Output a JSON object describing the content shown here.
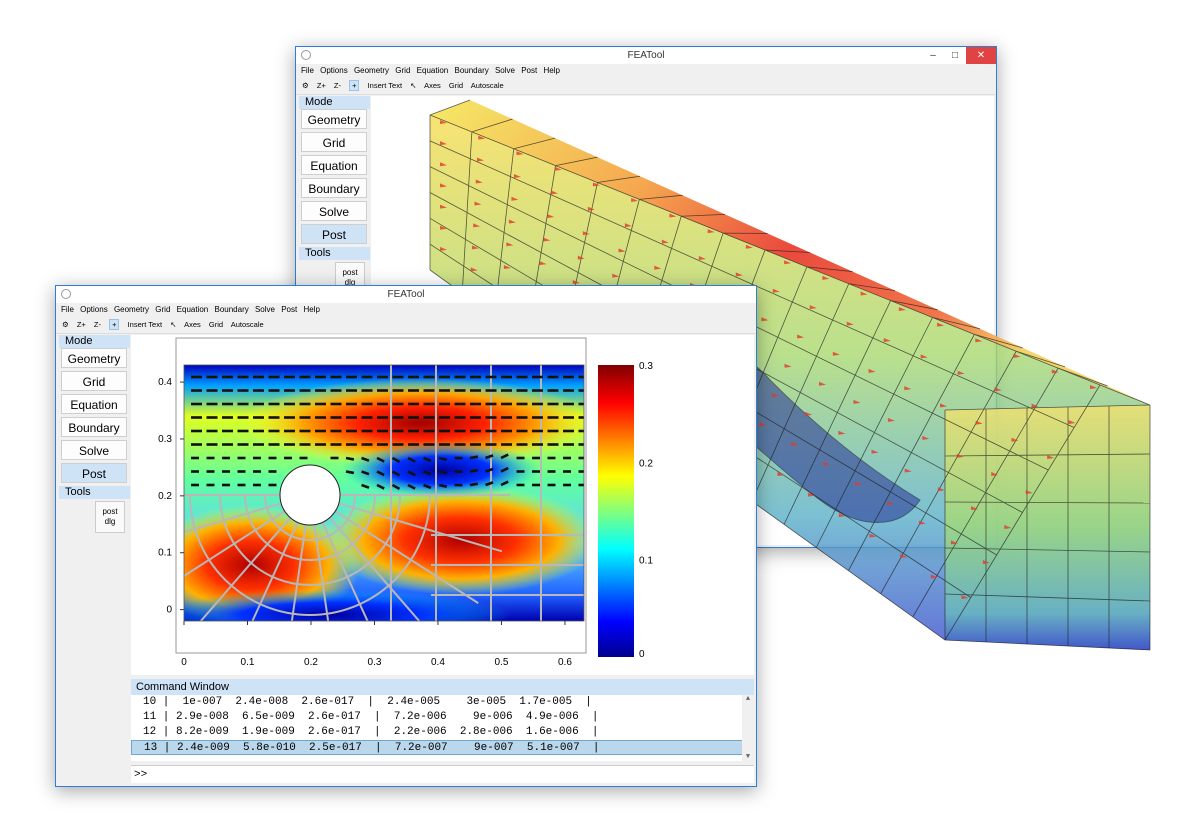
{
  "window_back": {
    "title": "FEATool",
    "menu": [
      "File",
      "Options",
      "Geometry",
      "Grid",
      "Equation",
      "Boundary",
      "Solve",
      "Post",
      "Help"
    ],
    "toolbar": [
      "Z+",
      "Z-",
      "+",
      "Insert Text",
      "Axes",
      "Grid",
      "Autoscale"
    ],
    "mode_label": "Mode",
    "modes": [
      "Geometry",
      "Grid",
      "Equation",
      "Boundary",
      "Solve",
      "Post"
    ],
    "tools_label": "Tools",
    "post_dlg": [
      "post",
      "dlg"
    ],
    "controls": [
      "–",
      "□",
      "✕"
    ]
  },
  "window_front": {
    "title": "FEATool",
    "menu": [
      "File",
      "Options",
      "Geometry",
      "Grid",
      "Equation",
      "Boundary",
      "Solve",
      "Post",
      "Help"
    ],
    "toolbar": [
      "Z+",
      "Z-",
      "+",
      "Insert Text",
      "Axes",
      "Grid",
      "Autoscale"
    ],
    "mode_label": "Mode",
    "modes": [
      "Geometry",
      "Grid",
      "Equation",
      "Boundary",
      "Solve",
      "Post"
    ],
    "tools_label": "Tools",
    "post_dlg": [
      "post",
      "dlg"
    ],
    "command_window": {
      "title": "Command Window",
      "lines": [
        "10 |  1e-007  2.4e-008  2.6e-017  |  2.4e-005    3e-005  1.7e-005  |",
        "11 | 2.9e-008  6.5e-009  2.6e-017  |  7.2e-006    9e-006  4.9e-006  |",
        "12 | 8.2e-009  1.9e-009  2.6e-017  |  2.2e-006  2.8e-006  1.6e-006  |",
        "13 | 2.4e-009  5.8e-010  2.5e-017  |  7.2e-007    9e-007  5.1e-007  |"
      ],
      "prompt": ">>"
    }
  },
  "chart_data": {
    "type": "heatmap",
    "x_ticks": [
      "0",
      "0.1",
      "0.2",
      "0.3",
      "0.4",
      "0.5",
      "0.6"
    ],
    "y_ticks": [
      "0",
      "0.1",
      "0.2",
      "0.3",
      "0.4"
    ],
    "xlim": [
      0,
      0.63
    ],
    "ylim": [
      -0.02,
      0.43
    ],
    "colorbar_ticks": [
      "0",
      "0.1",
      "0.2",
      "0.3"
    ],
    "colorbar_range": [
      0,
      0.3
    ],
    "grid": false,
    "colormap": "jet"
  }
}
